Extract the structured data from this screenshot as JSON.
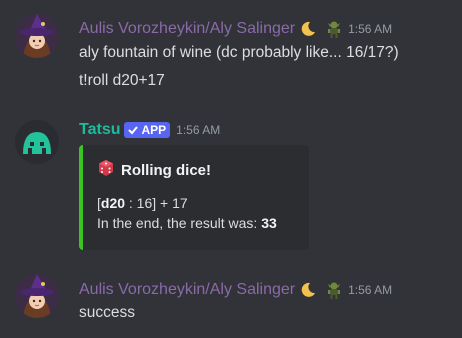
{
  "messages": [
    {
      "username": "Aulis Vorozheykin/Aly Salinger",
      "timestamp": "1:56 AM",
      "lines": [
        "aly fountain of wine (dc probably like... 16/17?)",
        "t!roll d20+17"
      ]
    },
    {
      "username": "Tatsu",
      "badge": "APP",
      "timestamp": "1:56 AM",
      "embed": {
        "title": "Rolling dice!",
        "roll_prefix": "[",
        "roll_die": "d20",
        "roll_suffix": " : 16] + 17",
        "result_prefix": "In the end, the result was: ",
        "result_value": "33",
        "accent_color": "#3bc424"
      }
    },
    {
      "username": "Aulis Vorozheykin/Aly Salinger",
      "timestamp": "1:56 AM",
      "lines": [
        "success"
      ]
    }
  ],
  "colors": {
    "background": "#323339",
    "username_user": "#8a6aa8",
    "username_bot": "#1abc9c",
    "badge": "#5865f2",
    "embed_bg": "#2b2d31"
  },
  "icons": [
    "witch-avatar-icon",
    "crescent-moon-icon",
    "goblin-role-icon",
    "tatsu-avatar-icon",
    "verified-check-icon",
    "dice-icon"
  ]
}
